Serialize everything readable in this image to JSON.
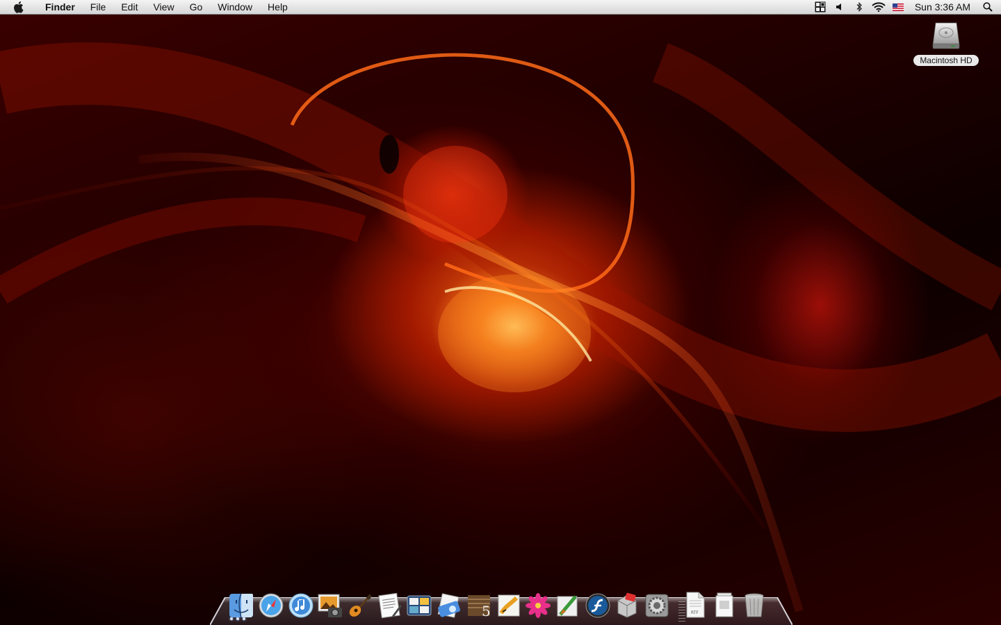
{
  "menubar": {
    "apple_icon": "apple-logo-icon",
    "app_name": "Finder",
    "menus": [
      "File",
      "Edit",
      "View",
      "Go",
      "Window",
      "Help"
    ],
    "status_icons": [
      "spaces-icon",
      "volume-icon",
      "bluetooth-icon",
      "wifi-icon",
      "us-flag-input-icon"
    ],
    "clock": "Sun 3:36 AM",
    "spotlight_icon": "spotlight-search-icon"
  },
  "desktop": {
    "icons": [
      {
        "label": "Macintosh HD",
        "icon": "hard-drive-icon"
      }
    ]
  },
  "dock": {
    "apps": [
      {
        "name": "Finder",
        "icon": "finder-icon",
        "running": true
      },
      {
        "name": "Safari",
        "icon": "safari-compass-icon"
      },
      {
        "name": "iTunes",
        "icon": "itunes-icon"
      },
      {
        "name": "iPhoto",
        "icon": "iphoto-icon"
      },
      {
        "name": "GarageBand",
        "icon": "garageband-guitar-icon"
      },
      {
        "name": "TextEdit",
        "icon": "textedit-icon"
      },
      {
        "name": "Dashboard",
        "icon": "dashboard-icon"
      },
      {
        "name": "Preview",
        "icon": "preview-icon"
      },
      {
        "name": "Dreamweaver",
        "icon": "adobe-cs5-icon"
      },
      {
        "name": "Illustrator",
        "icon": "illustrator-icon"
      },
      {
        "name": "Flower App",
        "icon": "pink-flower-icon"
      },
      {
        "name": "Brush Tool",
        "icon": "brush-tool-icon"
      },
      {
        "name": "Flash",
        "icon": "flash-icon"
      },
      {
        "name": "Installer",
        "icon": "installer-icon"
      },
      {
        "name": "System Preferences",
        "icon": "system-preferences-icon"
      }
    ],
    "documents": [
      {
        "name": "RTF Document",
        "icon": "rtf-document-icon",
        "badge": "RTF"
      },
      {
        "name": "Documents Stack",
        "icon": "document-stack-icon"
      },
      {
        "name": "Trash",
        "icon": "trash-icon"
      }
    ]
  },
  "colors": {
    "menubar_top": "#f4f4f4",
    "menubar_bottom": "#d6d6d6",
    "wallpaper_base": "#1a0000",
    "wallpaper_glow": "#ff7a10"
  }
}
